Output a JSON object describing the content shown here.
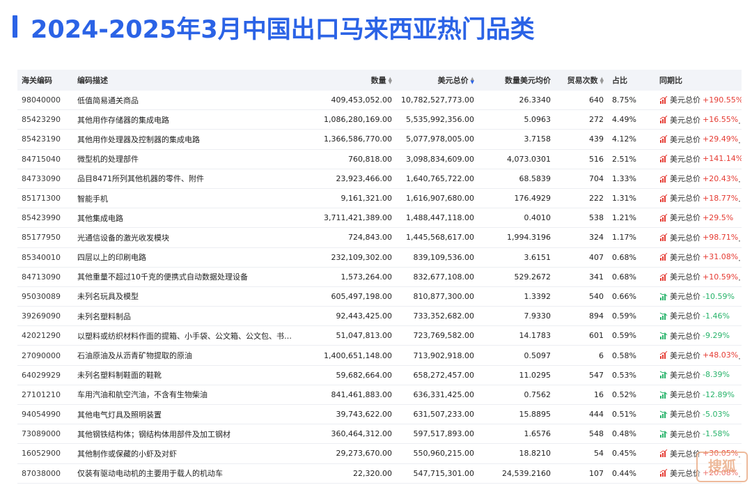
{
  "title": "2024-2025年3月中国出口马来西亚热门品类",
  "colors": {
    "accent": "#2b63e6",
    "up": "#e53b33",
    "down": "#27b36a"
  },
  "table": {
    "headers": {
      "code": "海关编码",
      "desc": "编码描述",
      "qty": "数量",
      "value": "美元总价",
      "avg": "数量美元均价",
      "count": "贸易次数",
      "share": "占比",
      "yoy": "同期比"
    },
    "yoy_label": "美元总价",
    "rows": [
      {
        "code": "98040000",
        "desc": "低值简易通关商品",
        "qty": "409,453,052.00",
        "value": "10,782,527,773.00",
        "avg": "26.3340",
        "count": "640",
        "share": "8.75%",
        "yoy": "+190.55%",
        "dir": "up"
      },
      {
        "code": "85423290",
        "desc": "其他用作存储器的集成电路",
        "qty": "1,086,280,169.00",
        "value": "5,535,992,356.00",
        "avg": "5.0963",
        "count": "272",
        "share": "4.49%",
        "yoy": "+16.55%",
        "dir": "up"
      },
      {
        "code": "85423190",
        "desc": "其他用作处理器及控制器的集成电路",
        "qty": "1,366,586,770.00",
        "value": "5,077,978,005.00",
        "avg": "3.7158",
        "count": "439",
        "share": "4.12%",
        "yoy": "+29.49%",
        "dir": "up"
      },
      {
        "code": "84715040",
        "desc": "微型机的处理部件",
        "qty": "760,818.00",
        "value": "3,098,834,609.00",
        "avg": "4,073.0301",
        "count": "516",
        "share": "2.51%",
        "yoy": "+141.14%",
        "dir": "up"
      },
      {
        "code": "84733090",
        "desc": "品目8471所列其他机器的零件、附件",
        "qty": "23,923,466.00",
        "value": "1,640,765,722.00",
        "avg": "68.5839",
        "count": "704",
        "share": "1.33%",
        "yoy": "+20.43%",
        "dir": "up"
      },
      {
        "code": "85171300",
        "desc": "智能手机",
        "qty": "9,161,321.00",
        "value": "1,616,907,680.00",
        "avg": "176.4929",
        "count": "222",
        "share": "1.31%",
        "yoy": "+18.77%",
        "dir": "up"
      },
      {
        "code": "85423990",
        "desc": "其他集成电路",
        "qty": "3,711,421,389.00",
        "value": "1,488,447,118.00",
        "avg": "0.4010",
        "count": "538",
        "share": "1.21%",
        "yoy": "+29.5%",
        "dir": "up"
      },
      {
        "code": "85177950",
        "desc": "光通信设备的激光收发模块",
        "qty": "724,843.00",
        "value": "1,445,568,617.00",
        "avg": "1,994.3196",
        "count": "324",
        "share": "1.17%",
        "yoy": "+98.71%",
        "dir": "up"
      },
      {
        "code": "85340010",
        "desc": "四层以上的印刷电路",
        "qty": "232,109,302.00",
        "value": "839,109,536.00",
        "avg": "3.6151",
        "count": "407",
        "share": "0.68%",
        "yoy": "+31.08%",
        "dir": "up"
      },
      {
        "code": "84713090",
        "desc": "其他重量不超过10千克的便携式自动数据处理设备",
        "qty": "1,573,264.00",
        "value": "832,677,108.00",
        "avg": "529.2672",
        "count": "341",
        "share": "0.68%",
        "yoy": "+10.59%",
        "dir": "up"
      },
      {
        "code": "95030089",
        "desc": "未列名玩具及模型",
        "qty": "605,497,198.00",
        "value": "810,877,300.00",
        "avg": "1.3392",
        "count": "540",
        "share": "0.66%",
        "yoy": "-10.59%",
        "dir": "down"
      },
      {
        "code": "39269090",
        "desc": "未列名塑料制品",
        "qty": "92,443,425.00",
        "value": "733,352,682.00",
        "avg": "7.9330",
        "count": "894",
        "share": "0.59%",
        "yoy": "-1.46%",
        "dir": "down"
      },
      {
        "code": "42021290",
        "desc": "以塑料或纺织材料作面的提箱、小手袋、公文箱、公文包、书…",
        "qty": "51,047,813.00",
        "value": "723,769,582.00",
        "avg": "14.1783",
        "count": "601",
        "share": "0.59%",
        "yoy": "-9.29%",
        "dir": "down"
      },
      {
        "code": "27090000",
        "desc": "石油原油及从沥青矿物提取的原油",
        "qty": "1,400,651,148.00",
        "value": "713,902,918.00",
        "avg": "0.5097",
        "count": "6",
        "share": "0.58%",
        "yoy": "+48.03%",
        "dir": "up"
      },
      {
        "code": "64029929",
        "desc": "未列名塑料制鞋面的鞋靴",
        "qty": "59,682,664.00",
        "value": "658,272,457.00",
        "avg": "11.0295",
        "count": "547",
        "share": "0.53%",
        "yoy": "-8.39%",
        "dir": "down"
      },
      {
        "code": "27101210",
        "desc": "车用汽油和航空汽油，不含有生物柴油",
        "qty": "841,461,883.00",
        "value": "636,331,425.00",
        "avg": "0.7562",
        "count": "16",
        "share": "0.52%",
        "yoy": "-12.89%",
        "dir": "down"
      },
      {
        "code": "94054990",
        "desc": "其他电气灯具及照明装置",
        "qty": "39,743,622.00",
        "value": "631,507,233.00",
        "avg": "15.8895",
        "count": "444",
        "share": "0.51%",
        "yoy": "-5.03%",
        "dir": "down"
      },
      {
        "code": "73089000",
        "desc": "其他钢铁结构体；钢结构体用部件及加工钢材",
        "qty": "360,464,312.00",
        "value": "597,517,893.00",
        "avg": "1.6576",
        "count": "548",
        "share": "0.48%",
        "yoy": "-1.58%",
        "dir": "down"
      },
      {
        "code": "16052900",
        "desc": "其他制作或保藏的小虾及对虾",
        "qty": "29,273,670.00",
        "value": "550,960,215.00",
        "avg": "18.8210",
        "count": "54",
        "share": "0.45%",
        "yoy": "+30.05%",
        "dir": "up"
      },
      {
        "code": "87038000",
        "desc": "仅装有驱动电动机的主要用于载人的机动车",
        "qty": "22,320.00",
        "value": "547,715,301.00",
        "avg": "24,539.2160",
        "count": "107",
        "share": "0.44%",
        "yoy": "+20.08%",
        "dir": "up"
      }
    ]
  },
  "watermark": {
    "text": "搜狐"
  }
}
